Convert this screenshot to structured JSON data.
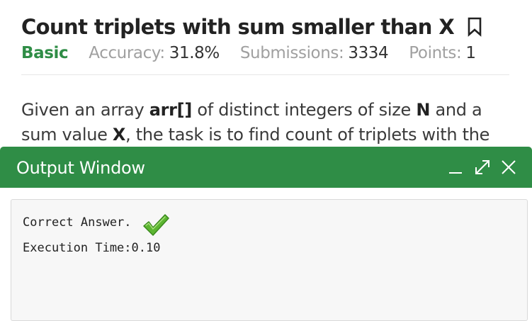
{
  "problem": {
    "title": "Count triplets with sum smaller than X",
    "difficulty": "Basic",
    "accuracy_label": "Accuracy:",
    "accuracy_value": "31.8%",
    "submissions_label": "Submissions:",
    "submissions_value": "3334",
    "points_label": "Points:",
    "points_value": "1",
    "description": {
      "p1": "Given an array ",
      "arr": "arr[]",
      "p2": " of distinct integers of size ",
      "n": "N",
      "p3": " and a sum value ",
      "x": "X",
      "p4": ", the task is to find count of triplets with the"
    }
  },
  "output_window": {
    "title": "Output Window",
    "result_text": "Correct Answer.",
    "execution_time": "Execution Time:0.10"
  },
  "colors": {
    "accent_green": "#2f8d46",
    "check_green": "#5cb531"
  },
  "icons": [
    "bookmark-icon",
    "minimize-icon",
    "expand-icon",
    "close-icon",
    "checkmark-icon"
  ]
}
